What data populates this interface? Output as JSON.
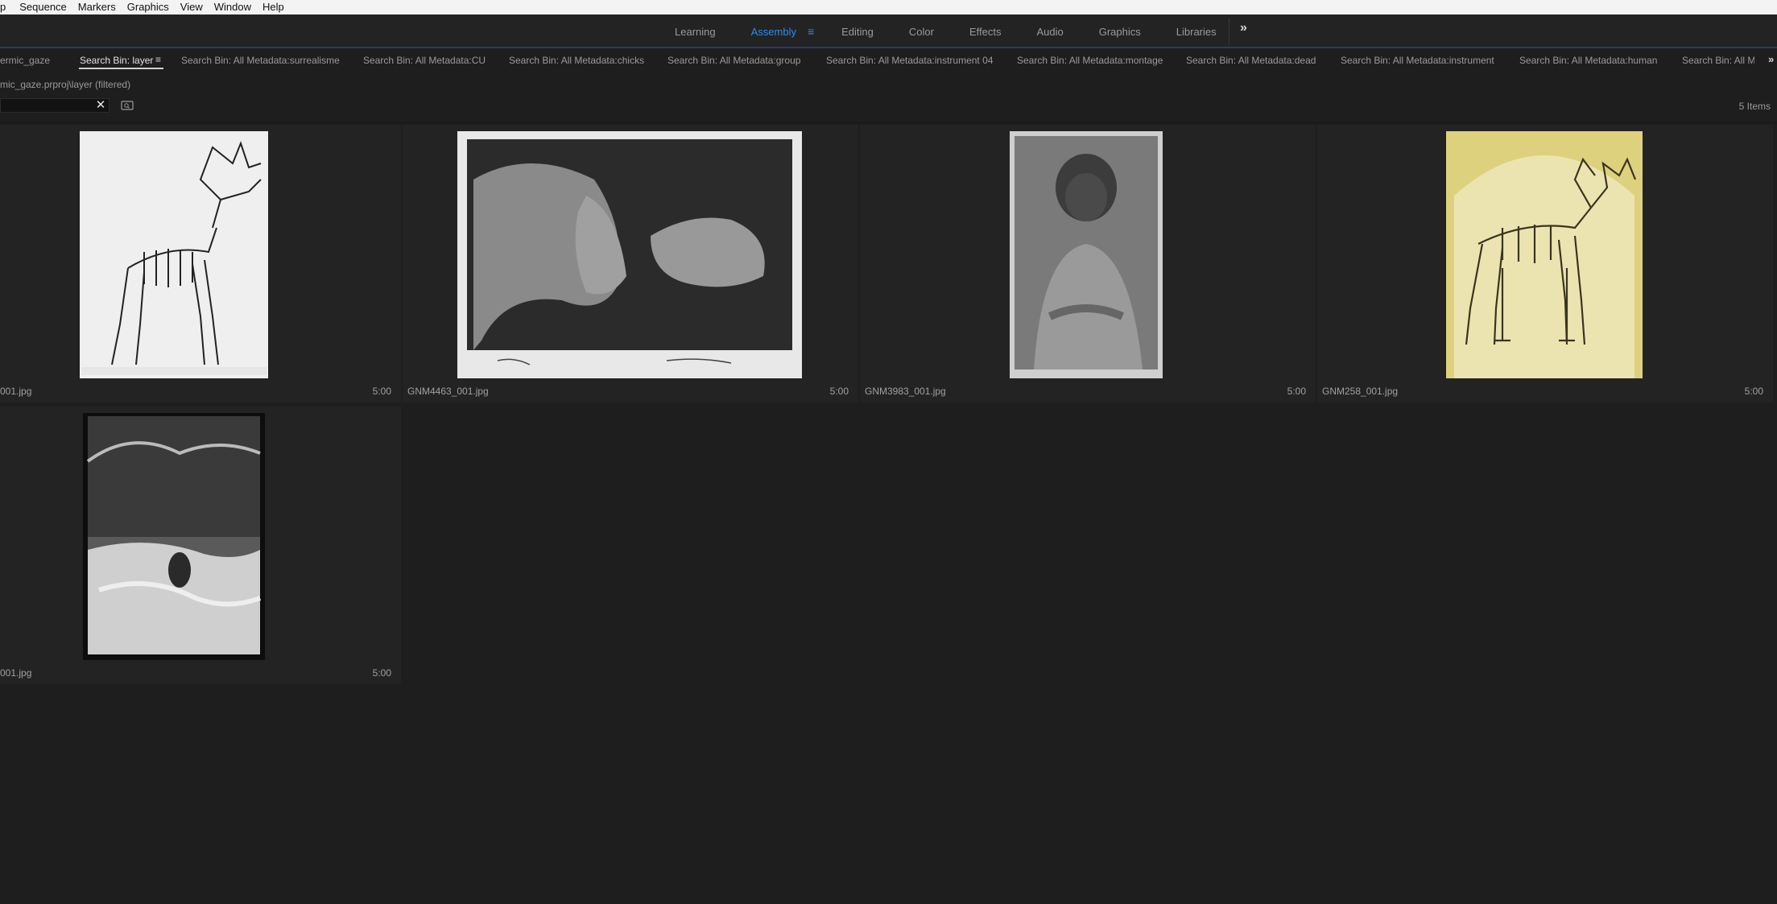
{
  "menu": [
    "p",
    "Sequence",
    "Markers",
    "Graphics",
    "View",
    "Window",
    "Help"
  ],
  "workspaces": {
    "tabs": [
      "Learning",
      "Assembly",
      "Editing",
      "Color",
      "Effects",
      "Audio",
      "Graphics",
      "Libraries"
    ],
    "active": "Assembly",
    "more_glyph": "»"
  },
  "panel_tabs": [
    "ermic_gaze",
    "Search Bin: layer",
    "Search Bin: All Metadata:surrealisme",
    "Search Bin: All Metadata:CU",
    "Search Bin: All Metadata:chicks",
    "Search Bin: All Metadata:group",
    "Search Bin: All Metadata:instrument 04",
    "Search Bin: All Metadata:montage",
    "Search Bin: All Metadata:dead",
    "Search Bin: All Metadata:instrument",
    "Search Bin: All Metadata:human",
    "Search Bin: All M"
  ],
  "active_panel_tab": "Search Bin: layer",
  "panel_more_glyph": "»",
  "bin": {
    "path": "mic_gaze.prproj\\layer (filtered)",
    "search_value": "",
    "item_count": "5 Items"
  },
  "items": [
    {
      "name": "001.jpg",
      "duration": "5:00",
      "image": "elk-skeleton-drawing-icon"
    },
    {
      "name": "GNM4463_001.jpg",
      "duration": "5:00",
      "image": "sculpture-photo-icon"
    },
    {
      "name": "GNM3983_001.jpg",
      "duration": "5:00",
      "image": "portrait-photo-icon"
    },
    {
      "name": "GNM258_001.jpg",
      "duration": "5:00",
      "image": "elk-skeleton-sepia-icon"
    },
    {
      "name": "001.jpg",
      "duration": "5:00",
      "image": "forest-river-photo-icon"
    }
  ],
  "colors": {
    "accent": "#2d8ceb",
    "panel_bg": "#1e1e1e",
    "cell_bg": "#232323"
  }
}
